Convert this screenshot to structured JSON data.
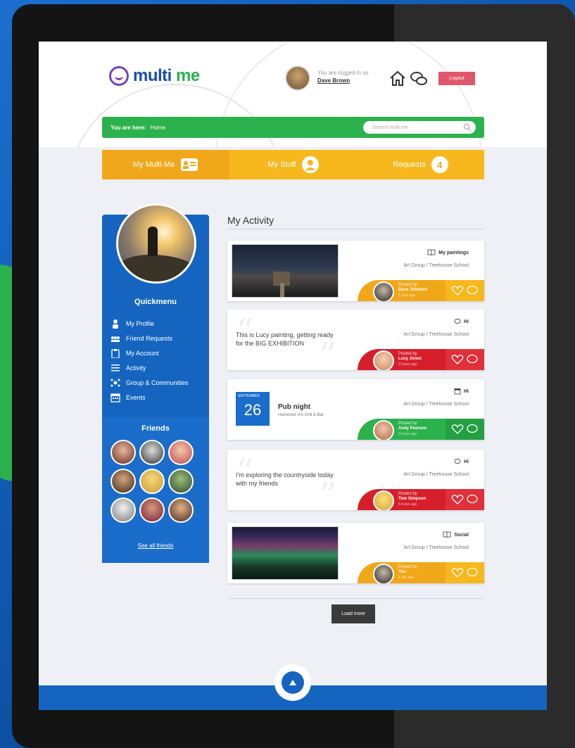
{
  "header": {
    "logo_multi": "multi",
    "logo_me": " me",
    "logged_in_label": "You are logged in as",
    "user_name": "Dave Brown",
    "logout_label": "Logout"
  },
  "breadcrumb": {
    "label": "You are here:",
    "current": "Home"
  },
  "search": {
    "placeholder": "Search multi me"
  },
  "nav": {
    "tabs": [
      {
        "label": "My Multi Me",
        "icon": "id-card-icon"
      },
      {
        "label": "My Stuff",
        "icon": "person-icon"
      },
      {
        "label": "Requests",
        "badge": "4"
      }
    ]
  },
  "sidebar": {
    "quickmenu_title": "Quickmenu",
    "items": [
      {
        "label": "My Profile",
        "icon": "person-icon"
      },
      {
        "label": "Friend Requests",
        "icon": "people-icon"
      },
      {
        "label": "My Account",
        "icon": "clipboard-icon"
      },
      {
        "label": "Activity",
        "icon": "list-icon"
      },
      {
        "label": "Group & Communities",
        "icon": "group-icon"
      },
      {
        "label": "Events",
        "icon": "calendar-icon"
      }
    ],
    "friends_title": "Friends",
    "see_all": "See all friends"
  },
  "main": {
    "title": "My Activity",
    "cards": [
      {
        "type": "image",
        "title": "My paintings",
        "subtitle": "Art Group / Treehouse School",
        "posted_by": "Posted by",
        "name": "Dave Johnson",
        "time": "1 hour ago",
        "color": "#f0a81a",
        "title_icon": "book-icon"
      },
      {
        "type": "quote",
        "text": "This is Lucy painting, getting ready for the BIG EXHIBITION",
        "title": "Hi",
        "subtitle": "Art Group / Treehouse School",
        "posted_by": "Posted by",
        "name": "Lucy Jones",
        "time": "2 hours ago",
        "color": "#d61f2b",
        "title_icon": "speech-icon"
      },
      {
        "type": "event",
        "month": "SEPTEMBER",
        "day": "26",
        "event_title": "Pub night",
        "event_place": "Harvester Inn Grill & Bar",
        "title": "Hi",
        "subtitle": "Art Group / Treehouse School",
        "posted_by": "Posted by",
        "name": "Andy Pearson",
        "time": "3 hours ago",
        "color": "#2bb24c",
        "title_icon": "calendar-icon"
      },
      {
        "type": "quote",
        "text": "I'm exploring the countryside today with my friends",
        "title": "Hi",
        "subtitle": "Art Group / Treehouse School",
        "posted_by": "Posted by",
        "name": "Tom Simpson",
        "time": "5 hours ago",
        "color": "#d61f2b",
        "title_icon": "speech-icon"
      },
      {
        "type": "image",
        "title": "Social",
        "subtitle": "Art Group / Treehouse School",
        "posted_by": "Posted by",
        "name": "You",
        "time": "1 day ago",
        "color": "#f0a81a",
        "title_icon": "book-icon"
      }
    ],
    "load_more": "Load more"
  }
}
